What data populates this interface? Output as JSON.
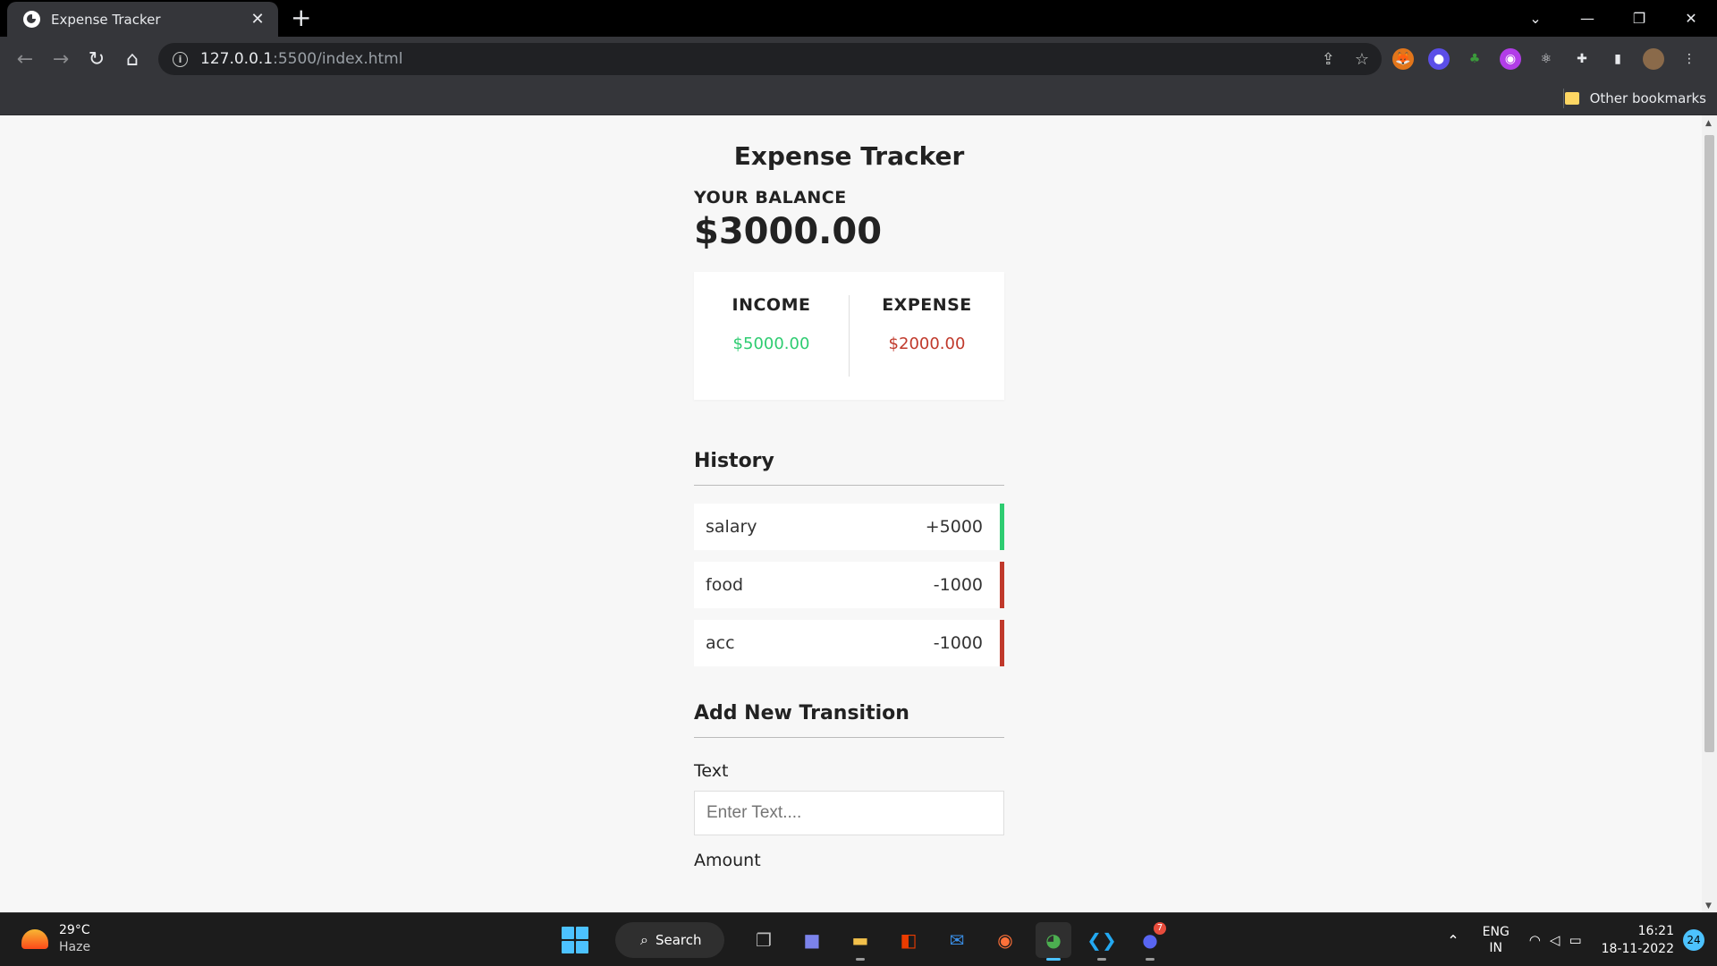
{
  "browser": {
    "tab_title": "Expense Tracker",
    "url_host": "127.0.0.1",
    "url_rest": ":5500/index.html",
    "other_bookmarks": "Other bookmarks"
  },
  "app": {
    "title": "Expense Tracker",
    "balance_label": "YOUR BALANCE",
    "balance_value": "$3000.00",
    "income_label": "INCOME",
    "income_value": "$5000.00",
    "expense_label": "EXPENSE",
    "expense_value": "$2000.00",
    "history_heading": "History",
    "history": [
      {
        "text": "salary",
        "amount": "+5000",
        "type": "plus"
      },
      {
        "text": "food",
        "amount": "-1000",
        "type": "minus"
      },
      {
        "text": "acc",
        "amount": "-1000",
        "type": "minus"
      }
    ],
    "add_heading": "Add New Transition",
    "text_label": "Text",
    "text_placeholder": "Enter Text....",
    "amount_label": "Amount"
  },
  "colors": {
    "income": "#2ecc71",
    "expense": "#c0392b"
  },
  "taskbar": {
    "temperature": "29°C",
    "weather": "Haze",
    "search_label": "Search",
    "discord_badge": "7",
    "lang_line1": "ENG",
    "lang_line2": "IN",
    "time": "16:21",
    "date": "18-11-2022",
    "notification_count": "24"
  }
}
